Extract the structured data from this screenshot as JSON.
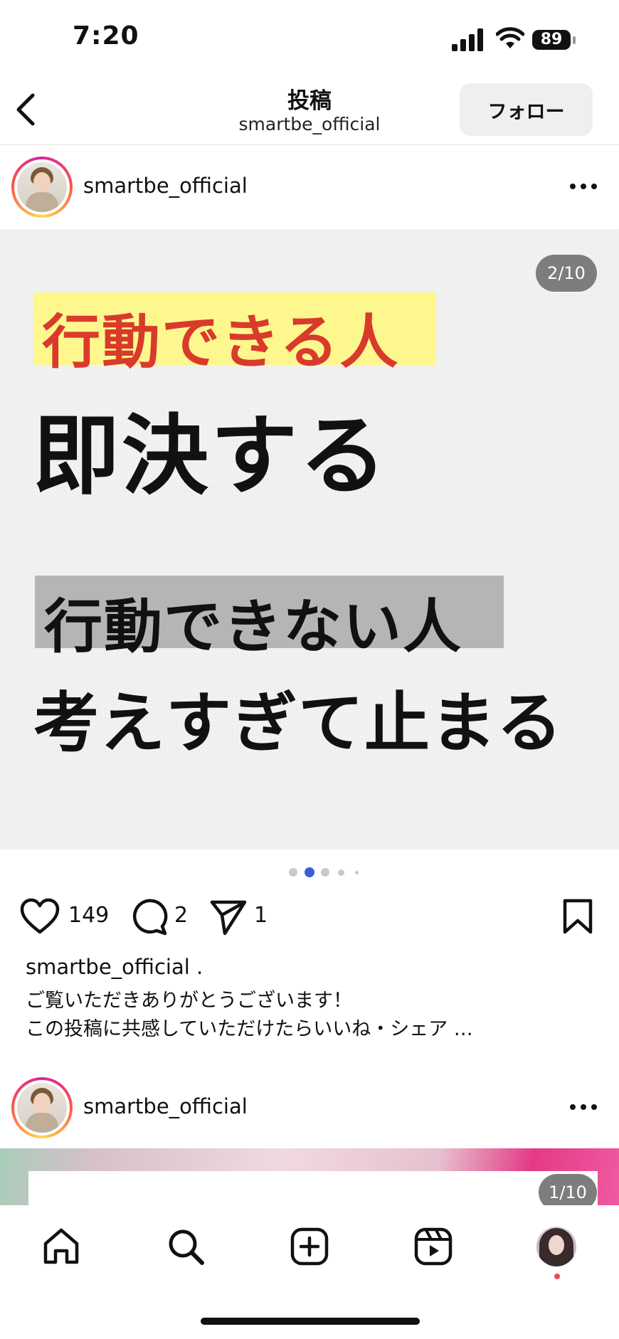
{
  "status_bar": {
    "time": "7:20",
    "battery": "89"
  },
  "header": {
    "title": "投稿",
    "subtitle": "smartbe_official",
    "follow_label": "フォロー"
  },
  "post": {
    "username": "smartbe_official",
    "slide": {
      "counter": "2/10",
      "line1": "行動できる人",
      "line2": "即決する",
      "line3": "行動できない人",
      "line4": "考えすぎて止まる",
      "highlight_color": "#fdf78d",
      "accent_color": "#d93a2c"
    },
    "carousel": {
      "current": 2,
      "dots_visible": 5
    },
    "likes": "149",
    "comments": "2",
    "shares": "1",
    "caption": {
      "username": "smartbe_official .",
      "line1": "ご覧いただきありがとうございます！",
      "line2": "この投稿に共感していただけたらいいね・シェア …"
    }
  },
  "post2": {
    "username": "smartbe_official",
    "counter": "1/10"
  },
  "bottom_nav": {
    "items": [
      "home-icon",
      "search-icon",
      "create-icon",
      "reels-icon",
      "profile-avatar"
    ],
    "notification_color": "#ed4956"
  }
}
